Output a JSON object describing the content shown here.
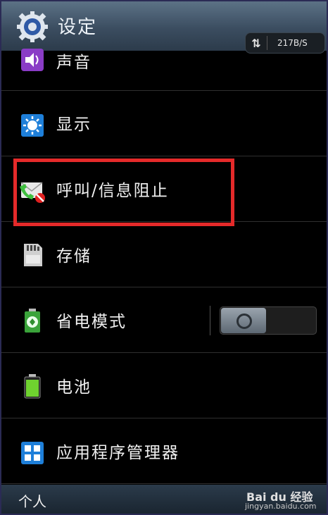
{
  "header": {
    "title": "设定",
    "network": {
      "speed": "217B/S"
    }
  },
  "items": [
    {
      "label": "声音",
      "icon": "sound-icon"
    },
    {
      "label": "显示",
      "icon": "display-icon"
    },
    {
      "label": "呼叫/信息阻止",
      "icon": "call-block-icon"
    },
    {
      "label": "存储",
      "icon": "storage-icon"
    },
    {
      "label": "省电模式",
      "icon": "power-saving-icon",
      "toggle": "off"
    },
    {
      "label": "电池",
      "icon": "battery-icon"
    },
    {
      "label": "应用程序管理器",
      "icon": "app-manager-icon"
    }
  ],
  "footer": {
    "section": "个人",
    "watermark": {
      "logo": "Bai du 经验",
      "url": "jingyan.baidu.com"
    }
  },
  "colors": {
    "header_top": "#5c7286",
    "highlight": "#e52a2a",
    "background": "#000000"
  }
}
